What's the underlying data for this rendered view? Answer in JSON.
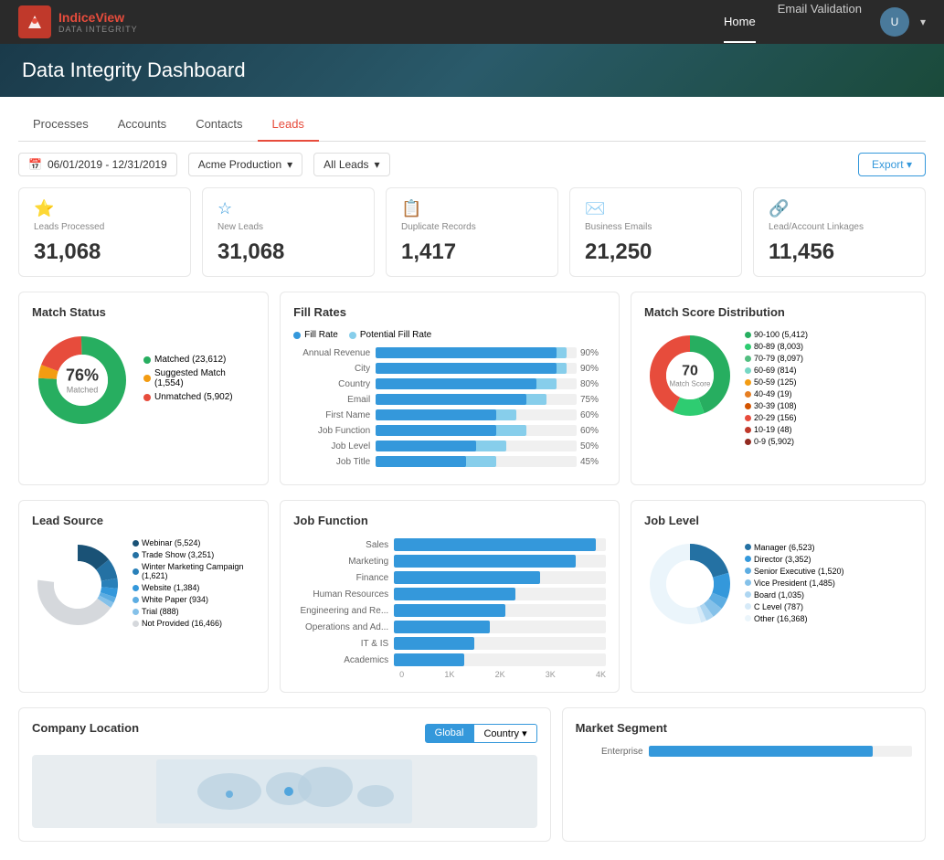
{
  "app": {
    "title": "IndiceView DATA INTEGRITY",
    "logo_text": "IndiceView",
    "logo_sub": "DATA INTEGRITY"
  },
  "nav": {
    "links": [
      "Home",
      "Email Validation"
    ],
    "active": "Home"
  },
  "page": {
    "title": "Data Integrity Dashboard"
  },
  "tabs": {
    "items": [
      "Processes",
      "Accounts",
      "Contacts",
      "Leads"
    ],
    "active": "Leads"
  },
  "filters": {
    "date_range": "06/01/2019 - 12/31/2019",
    "production": "Acme Production",
    "leads_filter": "All Leads",
    "export_label": "Export"
  },
  "summary_cards": [
    {
      "label": "Leads Processed",
      "value": "31,068",
      "icon": "star"
    },
    {
      "label": "New Leads",
      "value": "31,068",
      "icon": "star-outline"
    },
    {
      "label": "Duplicate Records",
      "value": "1,417",
      "icon": "copy"
    },
    {
      "label": "Business Emails",
      "value": "21,250",
      "icon": "email"
    },
    {
      "label": "Lead/Account Linkages",
      "value": "11,456",
      "icon": "link"
    }
  ],
  "match_status": {
    "title": "Match Status",
    "percentage": "76%",
    "label": "Matched",
    "legend": [
      {
        "label": "Matched (23,612)",
        "color": "#27ae60"
      },
      {
        "label": "Suggested Match (1,554)",
        "color": "#f39c12"
      },
      {
        "label": "Unmatched (5,902)",
        "color": "#e74c3c"
      }
    ]
  },
  "fill_rates": {
    "title": "Fill Rates",
    "legend": [
      {
        "label": "Fill Rate",
        "color": "#3498db"
      },
      {
        "label": "Potential Fill Rate",
        "color": "#87ceeb"
      }
    ],
    "rows": [
      {
        "label": "Annual Revenue",
        "actual": 90,
        "potential": 95
      },
      {
        "label": "City",
        "actual": 90,
        "potential": 95
      },
      {
        "label": "Country",
        "actual": 80,
        "potential": 90
      },
      {
        "label": "Email",
        "actual": 75,
        "potential": 85
      },
      {
        "label": "First Name",
        "actual": 60,
        "potential": 70
      },
      {
        "label": "Job Function",
        "actual": 60,
        "potential": 75
      },
      {
        "label": "Job Level",
        "actual": 50,
        "potential": 65
      },
      {
        "label": "Job Title",
        "actual": 45,
        "potential": 60
      }
    ]
  },
  "match_score": {
    "title": "Match Score Distribution",
    "center_value": "70",
    "center_label": "Match Score",
    "legend": [
      {
        "label": "90-100 (5,412)",
        "color": "#27ae60"
      },
      {
        "label": "80-89 (8,003)",
        "color": "#2ecc71"
      },
      {
        "label": "70-79 (8,097)",
        "color": "#52be80"
      },
      {
        "label": "60-69 (814)",
        "color": "#76d7c4"
      },
      {
        "label": "50-59 (125)",
        "color": "#f39c12"
      },
      {
        "label": "40-49 (19)",
        "color": "#e67e22"
      },
      {
        "label": "30-39 (108)",
        "color": "#d35400"
      },
      {
        "label": "20-29 (156)",
        "color": "#e74c3c"
      },
      {
        "label": "10-19 (48)",
        "color": "#c0392b"
      },
      {
        "label": "0-9 (5,902)",
        "color": "#922b21"
      }
    ]
  },
  "lead_source": {
    "title": "Lead Source",
    "legend": [
      {
        "label": "Webinar (5,524)",
        "color": "#1a5276"
      },
      {
        "label": "Trade Show (3,251)",
        "color": "#2471a3"
      },
      {
        "label": "Winter Marketing Campaign (1,621)",
        "color": "#2980b9"
      },
      {
        "label": "Website (1,384)",
        "color": "#3498db"
      },
      {
        "label": "White Paper (934)",
        "color": "#5dade2"
      },
      {
        "label": "Trial (888)",
        "color": "#85c1e9"
      },
      {
        "label": "Not Provided (16,466)",
        "color": "#d5d8dc"
      }
    ]
  },
  "job_function": {
    "title": "Job Function",
    "rows": [
      {
        "label": "Sales",
        "value": 4000,
        "max": 4200
      },
      {
        "label": "Marketing",
        "value": 3600,
        "max": 4200
      },
      {
        "label": "Finance",
        "value": 2900,
        "max": 4200
      },
      {
        "label": "Human Resources",
        "value": 2400,
        "max": 4200
      },
      {
        "label": "Engineering and Re...",
        "value": 2200,
        "max": 4200
      },
      {
        "label": "Operations and Ad...",
        "value": 1900,
        "max": 4200
      },
      {
        "label": "IT & IS",
        "value": 1600,
        "max": 4200
      },
      {
        "label": "Academics",
        "value": 1400,
        "max": 4200
      }
    ],
    "axis_labels": [
      "0",
      "1K",
      "2K",
      "3K",
      "4K"
    ]
  },
  "job_level": {
    "title": "Job Level",
    "legend": [
      {
        "label": "Manager (6,523)",
        "color": "#2471a3"
      },
      {
        "label": "Director (3,352)",
        "color": "#3498db"
      },
      {
        "label": "Senior Executive (1,520)",
        "color": "#5dade2"
      },
      {
        "label": "Vice President (1,485)",
        "color": "#85c1e9"
      },
      {
        "label": "Board (1,035)",
        "color": "#aed6f1"
      },
      {
        "label": "C Level (787)",
        "color": "#d6eaf8"
      },
      {
        "label": "Other (16,368)",
        "color": "#ebf5fb"
      }
    ]
  },
  "company_location": {
    "title": "Company Location",
    "btn_global": "Global",
    "btn_country": "Country"
  },
  "market_segment": {
    "title": "Market Segment",
    "rows": [
      {
        "label": "Enterprise",
        "value": 85
      }
    ]
  }
}
